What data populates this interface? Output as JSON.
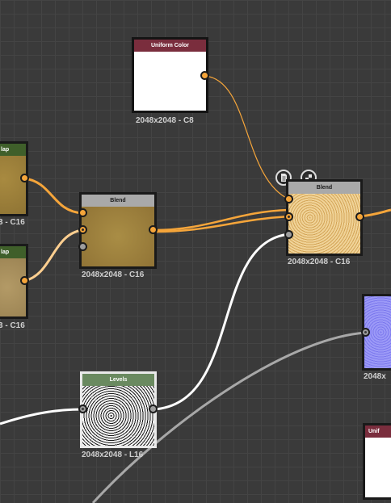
{
  "colors": {
    "canvas_bg": "#3a3a3a",
    "wire_orange": "#f5a53a",
    "wire_white": "#ffffff",
    "wire_gray": "#a8a8a8",
    "header_uniform": "#7a2d3d",
    "header_blend": "#a9a9a9",
    "header_levels": "#6a8a60",
    "header_map": "#3f5f2a"
  },
  "nodes": {
    "uniform_color": {
      "title": "Uniform Color",
      "info": "2048x2048 - C8"
    },
    "blend_left": {
      "title": "Blend",
      "info": "2048x2048 - C16"
    },
    "blend_right": {
      "title": "Blend",
      "info": "2048x2048 - C16"
    },
    "levels": {
      "title": "Levels",
      "info": "2048x2048 - L16"
    },
    "map_top": {
      "title": "Map",
      "info": "- C16",
      "visible_title": "lap",
      "visible_info": "3 - C16"
    },
    "map_bottom": {
      "title": "Map",
      "info": "- C16",
      "visible_title": "lap",
      "visible_info": "3 - C16"
    },
    "normal_right": {
      "info": "2048x"
    },
    "uniform_right": {
      "title": "Unif"
    }
  },
  "toolbar": {
    "icons": [
      "document-icon",
      "checker-icon"
    ]
  }
}
